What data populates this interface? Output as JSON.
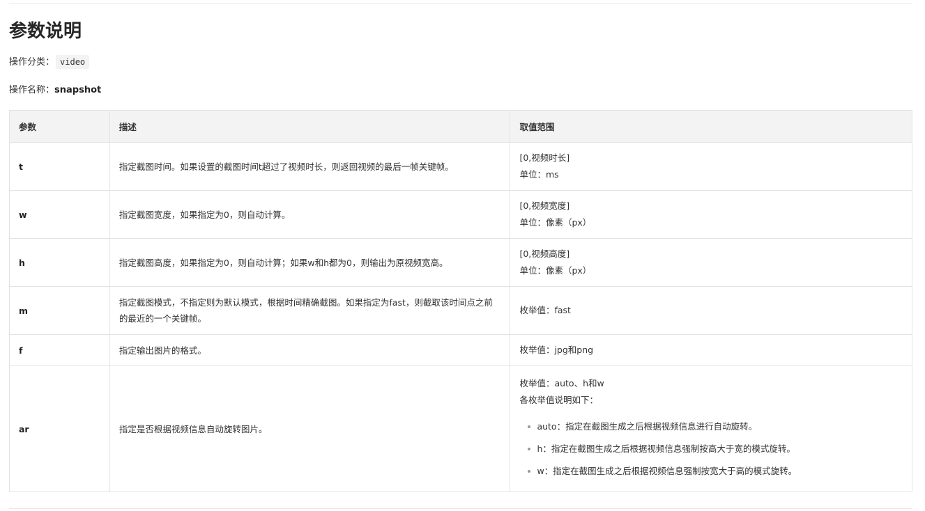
{
  "heading": "参数说明",
  "operation_category": {
    "label": "操作分类：",
    "value": "video"
  },
  "operation_name": {
    "label": "操作名称：",
    "value": "snapshot"
  },
  "table": {
    "headers": [
      "参数",
      "描述",
      "取值范围"
    ],
    "rows": [
      {
        "param": "t",
        "desc": "指定截图时间。如果设置的截图时间t超过了视频时长，则返回视频的最后一帧关键帧。",
        "range_lines": [
          "[0,视频时长]",
          "单位：ms"
        ]
      },
      {
        "param": "w",
        "desc": "指定截图宽度，如果指定为0，则自动计算。",
        "range_lines": [
          "[0,视频宽度]",
          "单位：像素（px）"
        ]
      },
      {
        "param": "h",
        "desc": "指定截图高度，如果指定为0，则自动计算；如果w和h都为0，则输出为原视频宽高。",
        "range_lines": [
          "[0,视频高度]",
          "单位：像素（px）"
        ]
      },
      {
        "param": "m",
        "desc": "指定截图模式，不指定则为默认模式，根据时间精确截图。如果指定为fast，则截取该时间点之前的最近的一个关键帧。",
        "range_lines": [
          "枚举值：fast"
        ]
      },
      {
        "param": "f",
        "desc": "指定输出图片的格式。",
        "range_lines": [
          "枚举值：jpg和png"
        ]
      },
      {
        "param": "ar",
        "desc": "指定是否根据视频信息自动旋转图片。",
        "range_lines": [
          "枚举值：auto、h和w",
          "各枚举值说明如下："
        ],
        "range_bullets": [
          "auto：指定在截图生成之后根据视频信息进行自动旋转。",
          "h：指定在截图生成之后根据视频信息强制按高大于宽的模式旋转。",
          "w：指定在截图生成之后根据视频信息强制按宽大于高的模式旋转。"
        ]
      }
    ]
  }
}
